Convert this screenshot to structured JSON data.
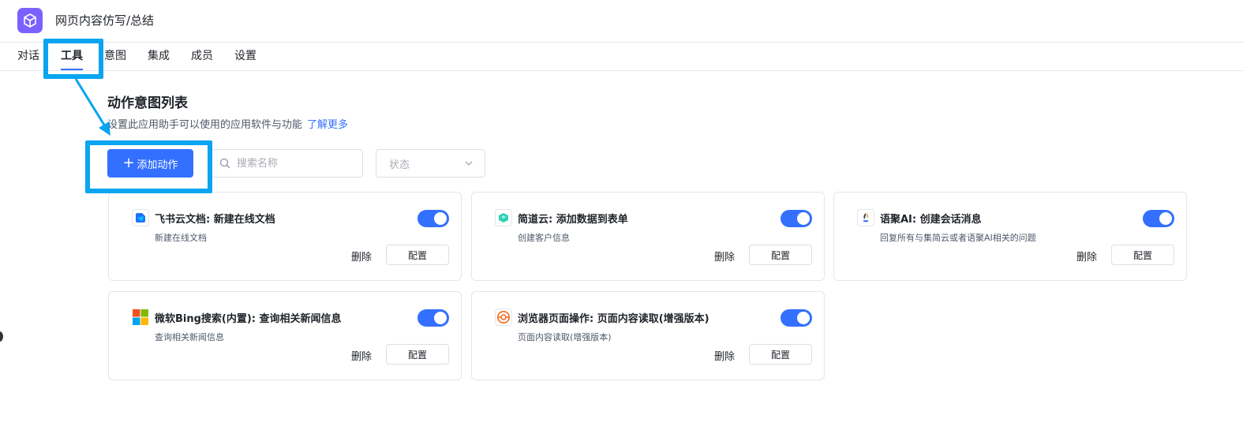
{
  "app": {
    "title": "网页内容仿写/总结",
    "icon": "cube-icon",
    "icon_color": "#7b61ff"
  },
  "tabs": [
    {
      "label": "对话",
      "active": false
    },
    {
      "label": "工具",
      "active": true
    },
    {
      "label": "意图",
      "active": false
    },
    {
      "label": "集成",
      "active": false
    },
    {
      "label": "成员",
      "active": false
    },
    {
      "label": "设置",
      "active": false
    }
  ],
  "page": {
    "title": "动作意图列表",
    "description": "设置此应用助手可以使用的应用软件与功能",
    "learn_more": "了解更多"
  },
  "toolbar": {
    "add_button": "添加动作",
    "search_placeholder": "搜索名称",
    "status_placeholder": "状态"
  },
  "cards": [
    {
      "title": "飞书云文档:   新建在线文档",
      "desc": "新建在线文档",
      "enabled": true,
      "icon": "feishu-docs-icon",
      "delete": "删除",
      "config": "配置"
    },
    {
      "title": "简道云:   添加数据到表单",
      "desc": "创建客户信息",
      "enabled": true,
      "icon": "jiandaoyun-icon",
      "delete": "删除",
      "config": "配置"
    },
    {
      "title": "语聚AI:   创建会话消息",
      "desc": "回复所有与集简云或者语聚AI相关的问题",
      "enabled": true,
      "icon": "yuju-ai-icon",
      "delete": "删除",
      "config": "配置"
    },
    {
      "title": "微软Bing搜索(内置):   查询相关新闻信息",
      "desc": "查询相关新闻信息",
      "enabled": true,
      "icon": "microsoft-icon",
      "delete": "删除",
      "config": "配置"
    },
    {
      "title": "浏览器页面操作:   页面内容读取(增强版本)",
      "desc": "页面内容读取(增强版本)",
      "enabled": true,
      "icon": "browser-icon",
      "delete": "删除",
      "config": "配置"
    }
  ],
  "colors": {
    "accent": "#3370ff",
    "highlight": "#0aa5f0"
  }
}
